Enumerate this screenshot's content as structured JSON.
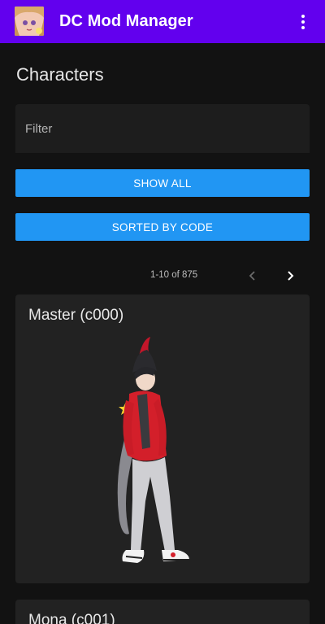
{
  "appbar": {
    "title": "DC Mod Manager",
    "logo_icon": "avatar-logo-icon",
    "menu_icon": "more-vert-icon",
    "background": "#6200ee"
  },
  "main": {
    "section_title": "Characters",
    "filter": {
      "placeholder": "Filter",
      "value": ""
    },
    "buttons": {
      "show_all": "SHOW ALL",
      "sorted": "SORTED BY CODE"
    },
    "pager": {
      "label": "1-10 of 875",
      "prev_icon": "chevron-left-icon",
      "next_icon": "chevron-right-icon"
    },
    "characters": [
      {
        "title": "Master (c000)"
      },
      {
        "title": "Mona (c001)"
      }
    ]
  },
  "colors": {
    "accent_button": "#2196f3",
    "background": "#121212",
    "card": "#222222"
  }
}
